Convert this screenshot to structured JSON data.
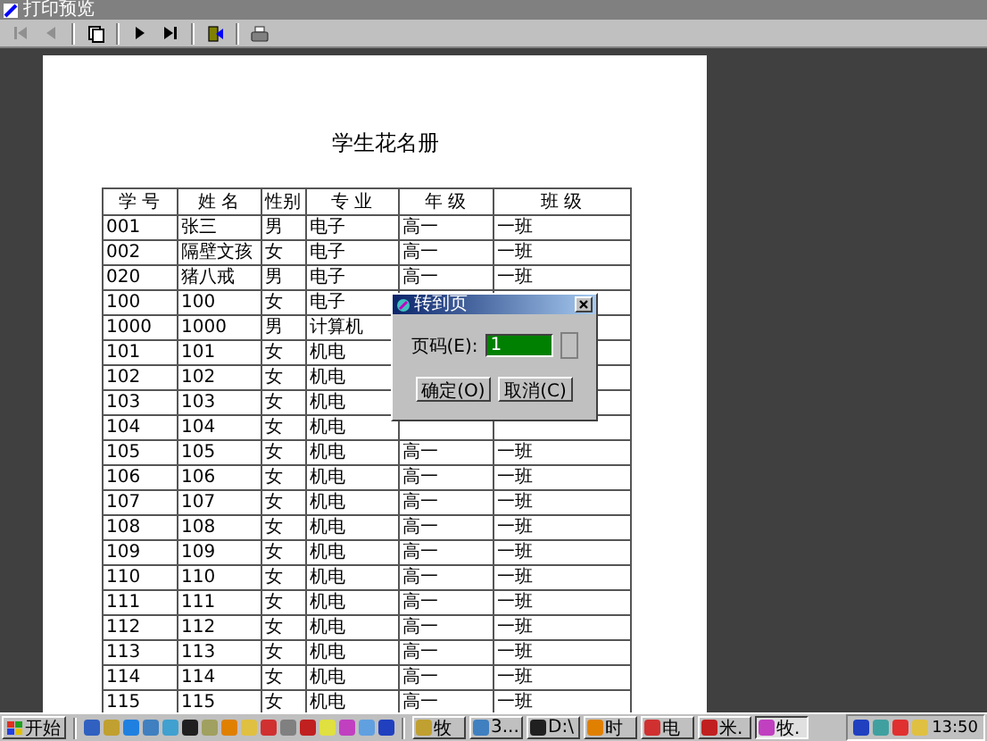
{
  "window": {
    "title": "打印预览"
  },
  "toolbar": [
    {
      "kind": "first",
      "disabled": true
    },
    {
      "kind": "prev",
      "disabled": true
    },
    {
      "kind": "pages",
      "disabled": false
    },
    {
      "kind": "next",
      "disabled": false
    },
    {
      "kind": "last",
      "disabled": false
    },
    {
      "kind": "close",
      "disabled": false
    },
    {
      "kind": "print",
      "disabled": false
    }
  ],
  "page": {
    "title": "学生花名册",
    "columns": [
      "学 号",
      "姓 名",
      "性别",
      "专 业",
      "年 级",
      "班 级"
    ],
    "rows": [
      [
        "001",
        "张三",
        "男",
        "电子",
        "高一",
        "一班"
      ],
      [
        "002",
        "隔壁文孩",
        "女",
        "电子",
        "高一",
        "一班"
      ],
      [
        "020",
        "猪八戒",
        "男",
        "电子",
        "高一",
        "一班"
      ],
      [
        "100",
        "100",
        "女",
        "电子",
        null,
        null
      ],
      [
        "1000",
        "1000",
        "男",
        "计算机",
        null,
        null
      ],
      [
        "101",
        "101",
        "女",
        "机电",
        null,
        null
      ],
      [
        "102",
        "102",
        "女",
        "机电",
        null,
        null
      ],
      [
        "103",
        "103",
        "女",
        "机电",
        null,
        null
      ],
      [
        "104",
        "104",
        "女",
        "机电",
        null,
        null
      ],
      [
        "105",
        "105",
        "女",
        "机电",
        "高一",
        "一班"
      ],
      [
        "106",
        "106",
        "女",
        "机电",
        "高一",
        "一班"
      ],
      [
        "107",
        "107",
        "女",
        "机电",
        "高一",
        "一班"
      ],
      [
        "108",
        "108",
        "女",
        "机电",
        "高一",
        "一班"
      ],
      [
        "109",
        "109",
        "女",
        "机电",
        "高一",
        "一班"
      ],
      [
        "110",
        "110",
        "女",
        "机电",
        "高一",
        "一班"
      ],
      [
        "111",
        "111",
        "女",
        "机电",
        "高一",
        "一班"
      ],
      [
        "112",
        "112",
        "女",
        "机电",
        "高一",
        "一班"
      ],
      [
        "113",
        "113",
        "女",
        "机电",
        "高一",
        "一班"
      ],
      [
        "114",
        "114",
        "女",
        "机电",
        "高一",
        "一班"
      ],
      [
        "115",
        "115",
        "女",
        "机电",
        "高一",
        "一班"
      ]
    ]
  },
  "dialog": {
    "title": "转到页",
    "label": "页码(E):",
    "value": "1",
    "buttons": [
      "确定(O)",
      "取消(C)"
    ]
  },
  "taskbar": {
    "start": "开始",
    "tasks": [
      {
        "label": "牧",
        "selected": false
      },
      {
        "label": "3...",
        "selected": false
      },
      {
        "label": "D:\\",
        "selected": false
      },
      {
        "label": "时",
        "selected": false
      },
      {
        "label": "电",
        "selected": false
      },
      {
        "label": "米.",
        "selected": false
      },
      {
        "label": "牧.",
        "selected": true
      }
    ],
    "clock": "13:50"
  }
}
